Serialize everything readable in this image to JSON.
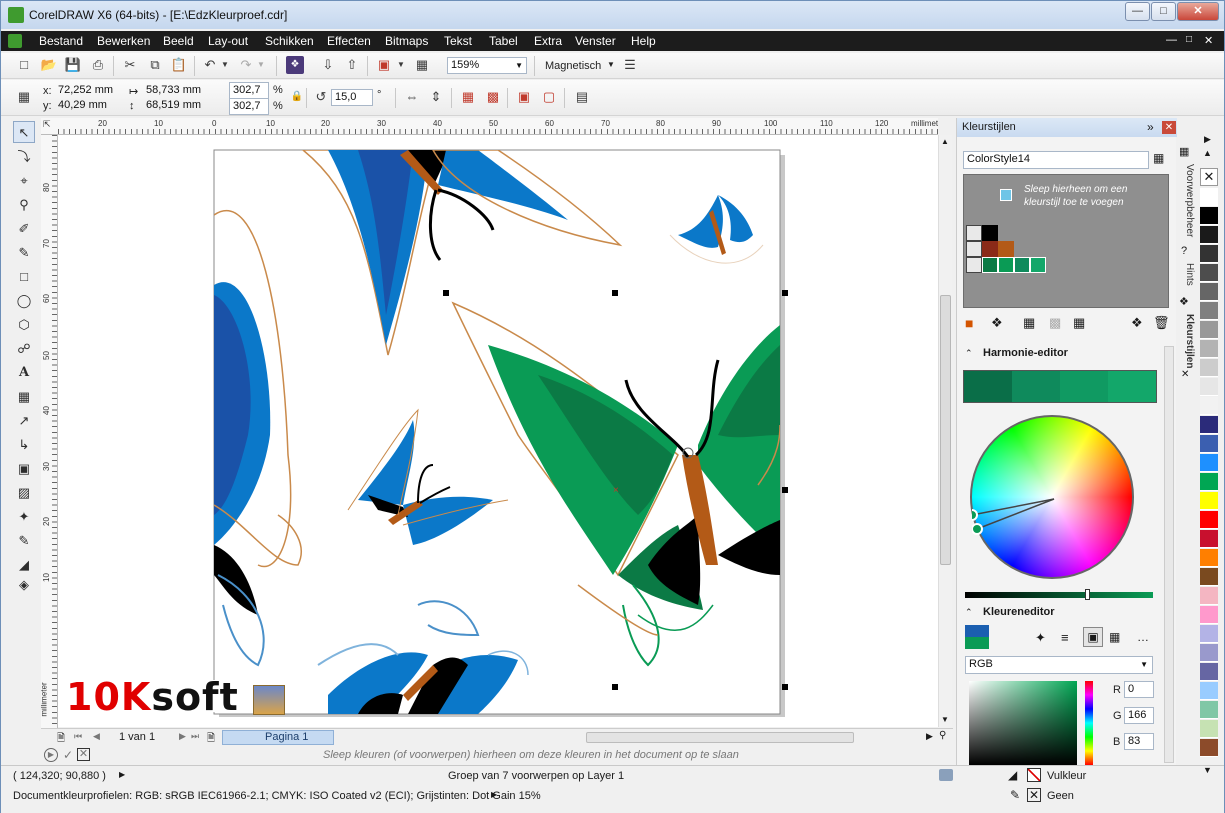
{
  "window": {
    "title": "CorelDRAW X6 (64-bits) - [E:\\EdzKleurproef.cdr]"
  },
  "menu": [
    "Bestand",
    "Bewerken",
    "Beeld",
    "Lay-out",
    "Schikken",
    "Effecten",
    "Bitmaps",
    "Tekst",
    "Tabel",
    "Extra",
    "Venster",
    "Help"
  ],
  "toolbar": {
    "zoom": "159%",
    "snap": "Magnetisch"
  },
  "props": {
    "x": "72,252 mm",
    "y": "40,29 mm",
    "w": "58,733 mm",
    "h": "68,519 mm",
    "scale_x": "302,7",
    "scale_y": "302,7",
    "pct": "%",
    "angle": "15,0",
    "deg": "°"
  },
  "rulers": {
    "h_ticks": [
      "20",
      "10",
      "0",
      "10",
      "20",
      "30",
      "40",
      "50",
      "60",
      "70",
      "80",
      "90",
      "100",
      "110",
      "120"
    ],
    "unit": "millimeter",
    "v_ticks": [
      "80",
      "70",
      "60",
      "50",
      "40",
      "30",
      "20",
      "10"
    ]
  },
  "pages": {
    "nav": "1 van 1",
    "tab": "Pagina 1"
  },
  "hint": "Sleep kleuren (of voorwerpen) hierheen om deze kleuren in het document op te slaan",
  "status": {
    "coords": "( 124,320; 90,880 )",
    "selection": "Groep van 7 voorwerpen op Layer 1",
    "profiles": "Documentkleurprofielen: RGB: sRGB IEC61966-2.1; CMYK: ISO Coated v2 (ECI); Grijstinten: Dot Gain 15%",
    "fill": "Vulkleur",
    "outline": "Geen"
  },
  "docker": {
    "title": "Kleurstijlen",
    "style_name": "ColorStyle14",
    "drop_hint": "Sleep hierheen om een kleurstijl toe te voegen",
    "harmony_title": "Harmonie-editor",
    "harmony_colors": [
      "#0a6e48",
      "#0f8a5c",
      "#109a62",
      "#13a76a"
    ],
    "color_editor_title": "Kleureneditor",
    "model": "RGB",
    "r_label": "R",
    "r": "0",
    "g_label": "G",
    "g": "166",
    "b_label": "B",
    "b": "83",
    "current_color": "#00a653"
  },
  "vtabs": [
    "Voorwerpbeheer",
    "Hints",
    "Kleurstijlen"
  ],
  "palette": [
    "#ffffff",
    "#000000",
    "#1a1a1a",
    "#333333",
    "#4d4d4d",
    "#666666",
    "#808080",
    "#999999",
    "#b3b3b3",
    "#cccccc",
    "#e6e6e6",
    "#f2f2f2",
    "#2b2b7a",
    "#3b5fb0",
    "#1e90ff",
    "#00a653",
    "#ffff00",
    "#ff0000",
    "#c8102e",
    "#ff7f00",
    "#7a4a1f",
    "#f4b6c2",
    "#ff99cc",
    "#b3b3e6",
    "#9999cc",
    "#6666a3",
    "#99ccff",
    "#80c7a6",
    "#c6e2b3",
    "#8c4b2a"
  ],
  "watermark": "10Ksoft"
}
